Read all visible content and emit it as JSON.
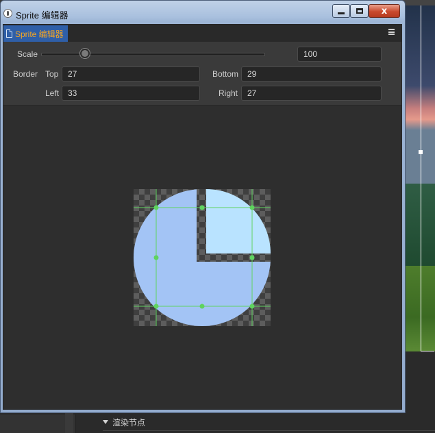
{
  "window": {
    "title": "Sprite 编辑器",
    "close_glyph": "x"
  },
  "tab": {
    "label": "Sprite 编辑器"
  },
  "properties": {
    "scale_label": "Scale",
    "scale_value": "100",
    "scale_slider_value": 19,
    "border_label": "Border",
    "top_label": "Top",
    "top_value": "27",
    "bottom_label": "Bottom",
    "bottom_value": "29",
    "left_label": "Left",
    "left_value": "33",
    "right_label": "Right",
    "right_value": "27"
  },
  "background": {
    "render_node_label": "渲染节点"
  },
  "colors": {
    "accent_tab": "#2f5fa8",
    "tab_text": "#f5a623",
    "slice_line": "#5fd35f",
    "sprite_fill": "#a3c4f5",
    "sprite_light": "#b9e3ff"
  },
  "icons": {
    "app": "app-icon",
    "tab": "document-icon",
    "menu": "hamburger-menu-icon",
    "minimize": "minimize-icon",
    "maximize": "maximize-icon",
    "close": "close-icon"
  }
}
